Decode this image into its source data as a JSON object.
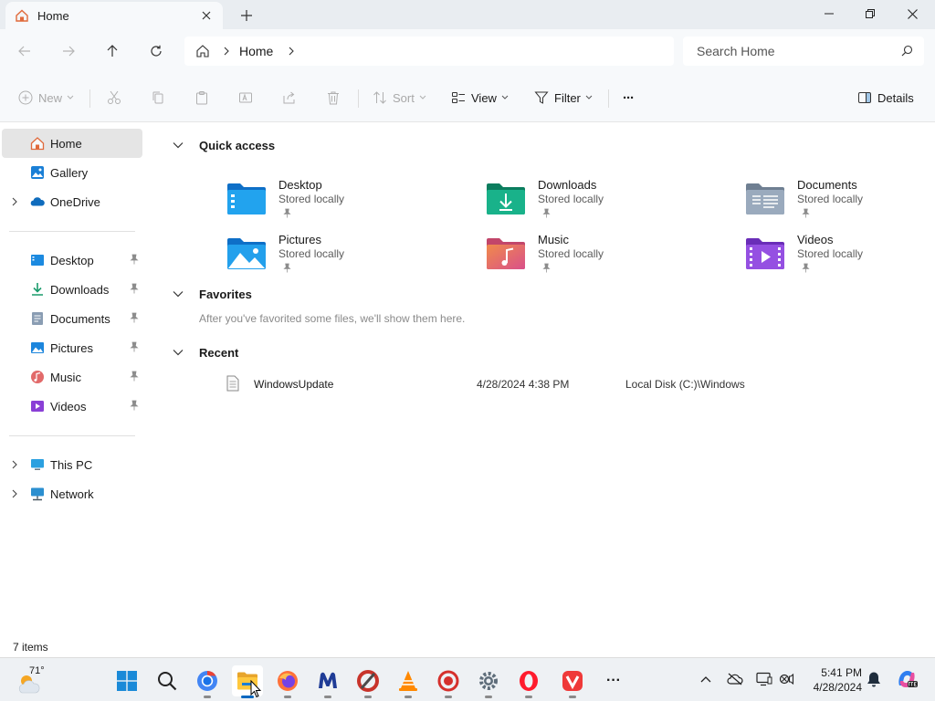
{
  "window": {
    "tab_title": "Home"
  },
  "nav": {
    "breadcrumb": "Home",
    "search_placeholder": "Search Home"
  },
  "toolbar": {
    "new_label": "New",
    "sort_label": "Sort",
    "view_label": "View",
    "filter_label": "Filter",
    "more_label": "···",
    "details_label": "Details"
  },
  "sidebar": {
    "top": [
      {
        "label": "Home",
        "icon": "home-icon"
      },
      {
        "label": "Gallery",
        "icon": "gallery-icon"
      },
      {
        "label": "OneDrive",
        "icon": "onedrive-icon"
      }
    ],
    "pinned": [
      {
        "label": "Desktop",
        "icon": "desktop-icon"
      },
      {
        "label": "Downloads",
        "icon": "downloads-icon"
      },
      {
        "label": "Documents",
        "icon": "documents-icon"
      },
      {
        "label": "Pictures",
        "icon": "pictures-icon"
      },
      {
        "label": "Music",
        "icon": "music-icon"
      },
      {
        "label": "Videos",
        "icon": "videos-icon"
      }
    ],
    "bottom": [
      {
        "label": "This PC",
        "icon": "this-pc-icon"
      },
      {
        "label": "Network",
        "icon": "network-icon"
      }
    ]
  },
  "main": {
    "quick_access_title": "Quick access",
    "quick_access": [
      {
        "name": "Desktop",
        "sub": "Stored locally"
      },
      {
        "name": "Downloads",
        "sub": "Stored locally"
      },
      {
        "name": "Documents",
        "sub": "Stored locally"
      },
      {
        "name": "Pictures",
        "sub": "Stored locally"
      },
      {
        "name": "Music",
        "sub": "Stored locally"
      },
      {
        "name": "Videos",
        "sub": "Stored locally"
      }
    ],
    "favorites_title": "Favorites",
    "favorites_empty": "After you've favorited some files, we'll show them here.",
    "recent_title": "Recent",
    "recent": [
      {
        "name": "WindowsUpdate",
        "date": "4/28/2024 4:38 PM",
        "location": "Local Disk (C:)\\Windows"
      }
    ]
  },
  "status": {
    "items": "7 items"
  },
  "taskbar": {
    "weather_temp": "71°",
    "time": "5:41 PM",
    "date": "4/28/2024",
    "more_apps": "···"
  },
  "colors": {
    "accent": "#0067c0",
    "folder_blue": "#1e90e8",
    "folder_green": "#14a37f",
    "folder_gray": "#8a99aa"
  }
}
